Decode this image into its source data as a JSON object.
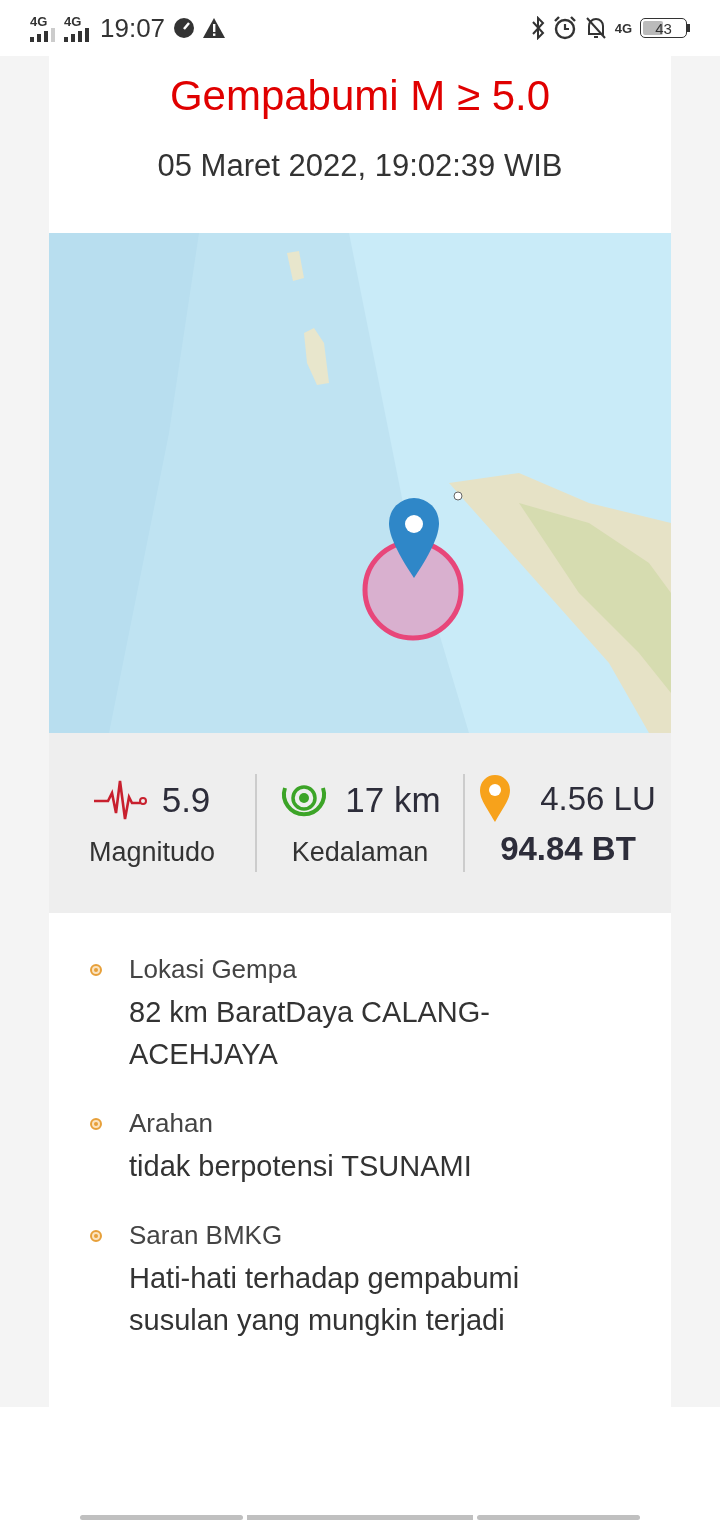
{
  "status_bar": {
    "signals": [
      {
        "label": "4G"
      },
      {
        "label": "4G"
      }
    ],
    "time": "19:07",
    "network": "4G",
    "battery": "43"
  },
  "header": {
    "title": "Gempabumi M ≥ 5.0",
    "datetime": "05 Maret 2022, 19:02:39 WIB"
  },
  "stats": {
    "magnitude": {
      "value": "5.9",
      "label": "Magnitudo"
    },
    "depth": {
      "value": "17 km",
      "label": "Kedalaman"
    },
    "location": {
      "latitude": "4.56 LU",
      "longitude": "94.84 BT"
    }
  },
  "details": [
    {
      "label": "Lokasi Gempa",
      "value": "82 km BaratDaya CALANG-ACEHJAYA"
    },
    {
      "label": "Arahan",
      "value": "tidak berpotensi TSUNAMI"
    },
    {
      "label": "Saran BMKG",
      "value": "Hati-hati terhadap gempabumi susulan yang mungkin terjadi"
    }
  ]
}
